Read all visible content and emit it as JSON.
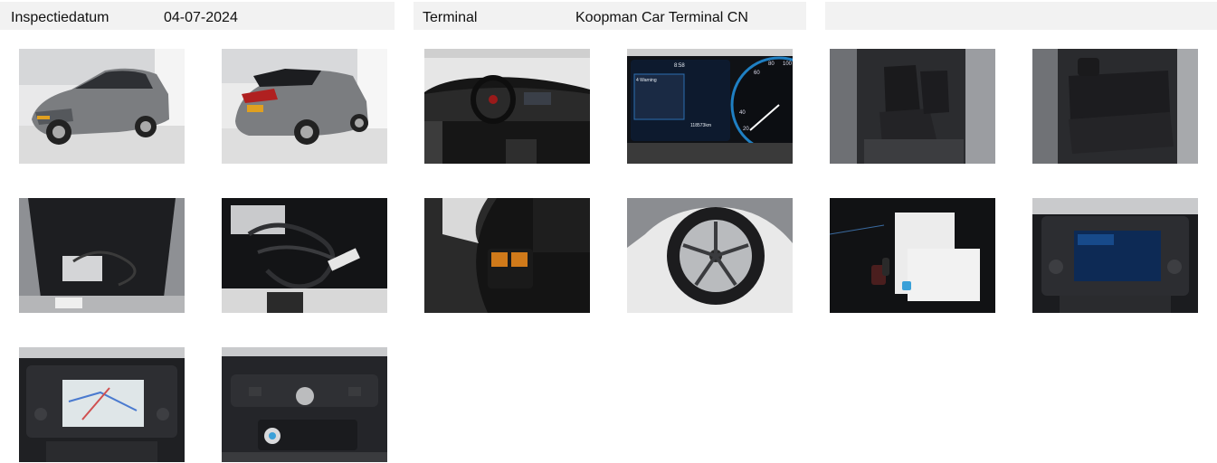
{
  "header": {
    "inspection_label": "Inspectiedatum",
    "inspection_date": "04-07-2024",
    "terminal_label": "Terminal",
    "terminal_value": "Koopman Car Terminal CN"
  },
  "photos": [
    {
      "subject": "exterior-front-three-quarter"
    },
    {
      "subject": "exterior-rear-three-quarter"
    },
    {
      "subject": "dashboard-interior"
    },
    {
      "subject": "instrument-cluster"
    },
    {
      "subject": "front-seats"
    },
    {
      "subject": "rear-seats"
    },
    {
      "subject": "trunk"
    },
    {
      "subject": "charging-cables"
    },
    {
      "subject": "repair-kit"
    },
    {
      "subject": "wheel-rim"
    },
    {
      "subject": "keys-and-manuals"
    },
    {
      "subject": "infotainment-screen"
    },
    {
      "subject": "navigation-screen"
    },
    {
      "subject": "center-console-controls"
    }
  ],
  "cluster": {
    "time": "8:58",
    "warning": "4 Warning",
    "odometer": "118573km",
    "gauge_ticks": [
      "20",
      "40",
      "60",
      "80",
      "100"
    ]
  },
  "colors": {
    "header_band": "#f2f2f2",
    "car_body": "#7b7d80"
  }
}
